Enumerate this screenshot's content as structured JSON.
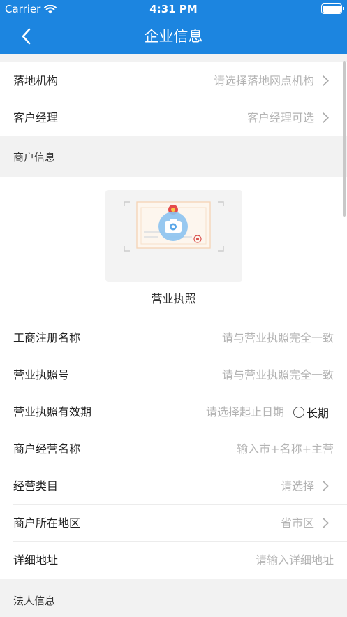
{
  "status_bar": {
    "carrier": "Carrier",
    "time": "4:31 PM"
  },
  "nav": {
    "title": "企业信息"
  },
  "rows_top": [
    {
      "label": "落地机构",
      "value": "请选择落地网点机构"
    },
    {
      "label": "客户经理",
      "value": "客户经理可选"
    }
  ],
  "section_merchant": {
    "title": "商户信息"
  },
  "license": {
    "caption": "营业执照"
  },
  "merchant_rows": {
    "reg_name": {
      "label": "工商注册名称",
      "placeholder": "请与营业执照完全一致"
    },
    "license_no": {
      "label": "营业执照号",
      "placeholder": "请与营业执照完全一致"
    },
    "validity": {
      "label": "营业执照有效期",
      "placeholder": "请选择起止日期",
      "long_term": "长期"
    },
    "biz_name": {
      "label": "商户经营名称",
      "placeholder": "输入市+名称+主营"
    },
    "category": {
      "label": "经营类目",
      "value": "请选择"
    },
    "region": {
      "label": "商户所在地区",
      "value": "省市区"
    },
    "address": {
      "label": "详细地址",
      "placeholder": "请输入详细地址"
    }
  },
  "section_legal": {
    "title": "法人信息"
  },
  "colors": {
    "primary": "#1c85e0",
    "placeholder": "#b3b3b3",
    "background": "#f2f2f2"
  }
}
